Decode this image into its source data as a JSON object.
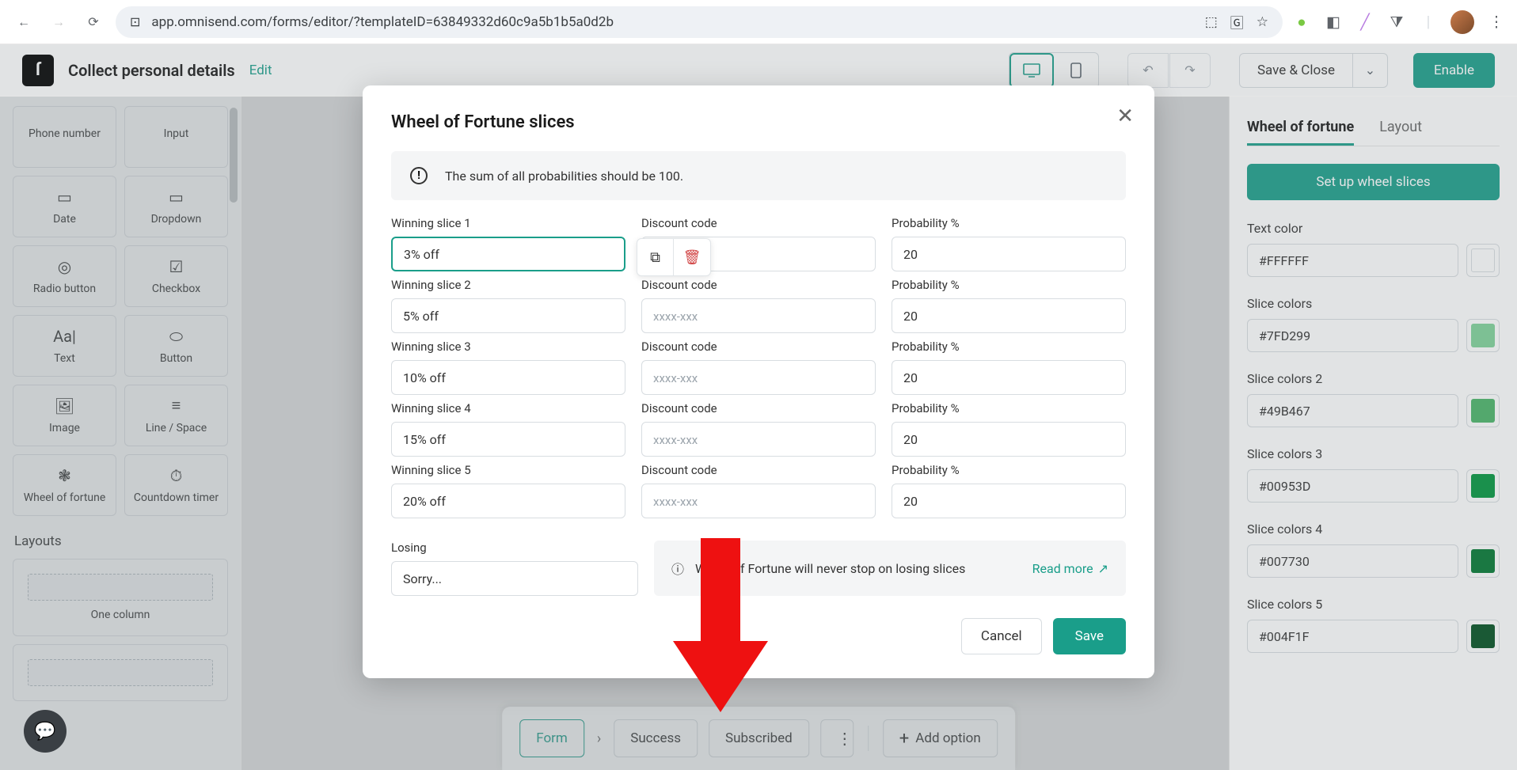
{
  "browser": {
    "url": "app.omnisend.com/forms/editor/?templateID=63849332d60c9a5b1b5a0d2b"
  },
  "header": {
    "title": "Collect personal details",
    "edit": "Edit",
    "save_close": "Save & Close",
    "enable": "Enable"
  },
  "left_panel": {
    "blocks": [
      {
        "label": "Phone number",
        "icon": "phone"
      },
      {
        "label": "Input",
        "icon": "input"
      },
      {
        "label": "Date",
        "icon": "date"
      },
      {
        "label": "Dropdown",
        "icon": "dropdown"
      },
      {
        "label": "Radio button",
        "icon": "radio"
      },
      {
        "label": "Checkbox",
        "icon": "checkbox"
      },
      {
        "label": "Text",
        "icon": "text"
      },
      {
        "label": "Button",
        "icon": "button"
      },
      {
        "label": "Image",
        "icon": "image"
      },
      {
        "label": "Line / Space",
        "icon": "line"
      },
      {
        "label": "Wheel of fortune",
        "icon": "wheel"
      },
      {
        "label": "Countdown timer",
        "icon": "timer"
      }
    ],
    "layouts_label": "Layouts",
    "layout_one_col": "One column"
  },
  "right_panel": {
    "tabs": {
      "wheel": "Wheel of fortune",
      "layout": "Layout"
    },
    "setup": "Set up wheel slices",
    "text_color_label": "Text color",
    "text_color_value": "#FFFFFF",
    "slice_labels": [
      "Slice colors",
      "Slice colors 2",
      "Slice colors 3",
      "Slice colors 4",
      "Slice colors 5"
    ],
    "slice_colors": [
      "#7FD299",
      "#49B467",
      "#00953D",
      "#007730",
      "#004F1F"
    ]
  },
  "bottom_nav": {
    "form": "Form",
    "success": "Success",
    "subscribed": "Subscribed",
    "add_option": "Add option"
  },
  "modal": {
    "title": "Wheel of Fortune slices",
    "warning": "The sum of all probabilities should be 100.",
    "cols": {
      "slice": "Winning slice",
      "code": "Discount code",
      "prob": "Probability %"
    },
    "code_placeholder": "xxxx-xxx",
    "rows": [
      {
        "n": "1",
        "slice": "3% off",
        "prob": "20"
      },
      {
        "n": "2",
        "slice": "5% off",
        "prob": "20"
      },
      {
        "n": "3",
        "slice": "10% off",
        "prob": "20"
      },
      {
        "n": "4",
        "slice": "15% off",
        "prob": "20"
      },
      {
        "n": "5",
        "slice": "20% off",
        "prob": "20"
      }
    ],
    "losing_label": "Losing",
    "losing_value": "Sorry...",
    "losing_info": "Wheel of Fortune will never stop on losing slices",
    "read_more": "Read more",
    "cancel": "Cancel",
    "save": "Save"
  }
}
